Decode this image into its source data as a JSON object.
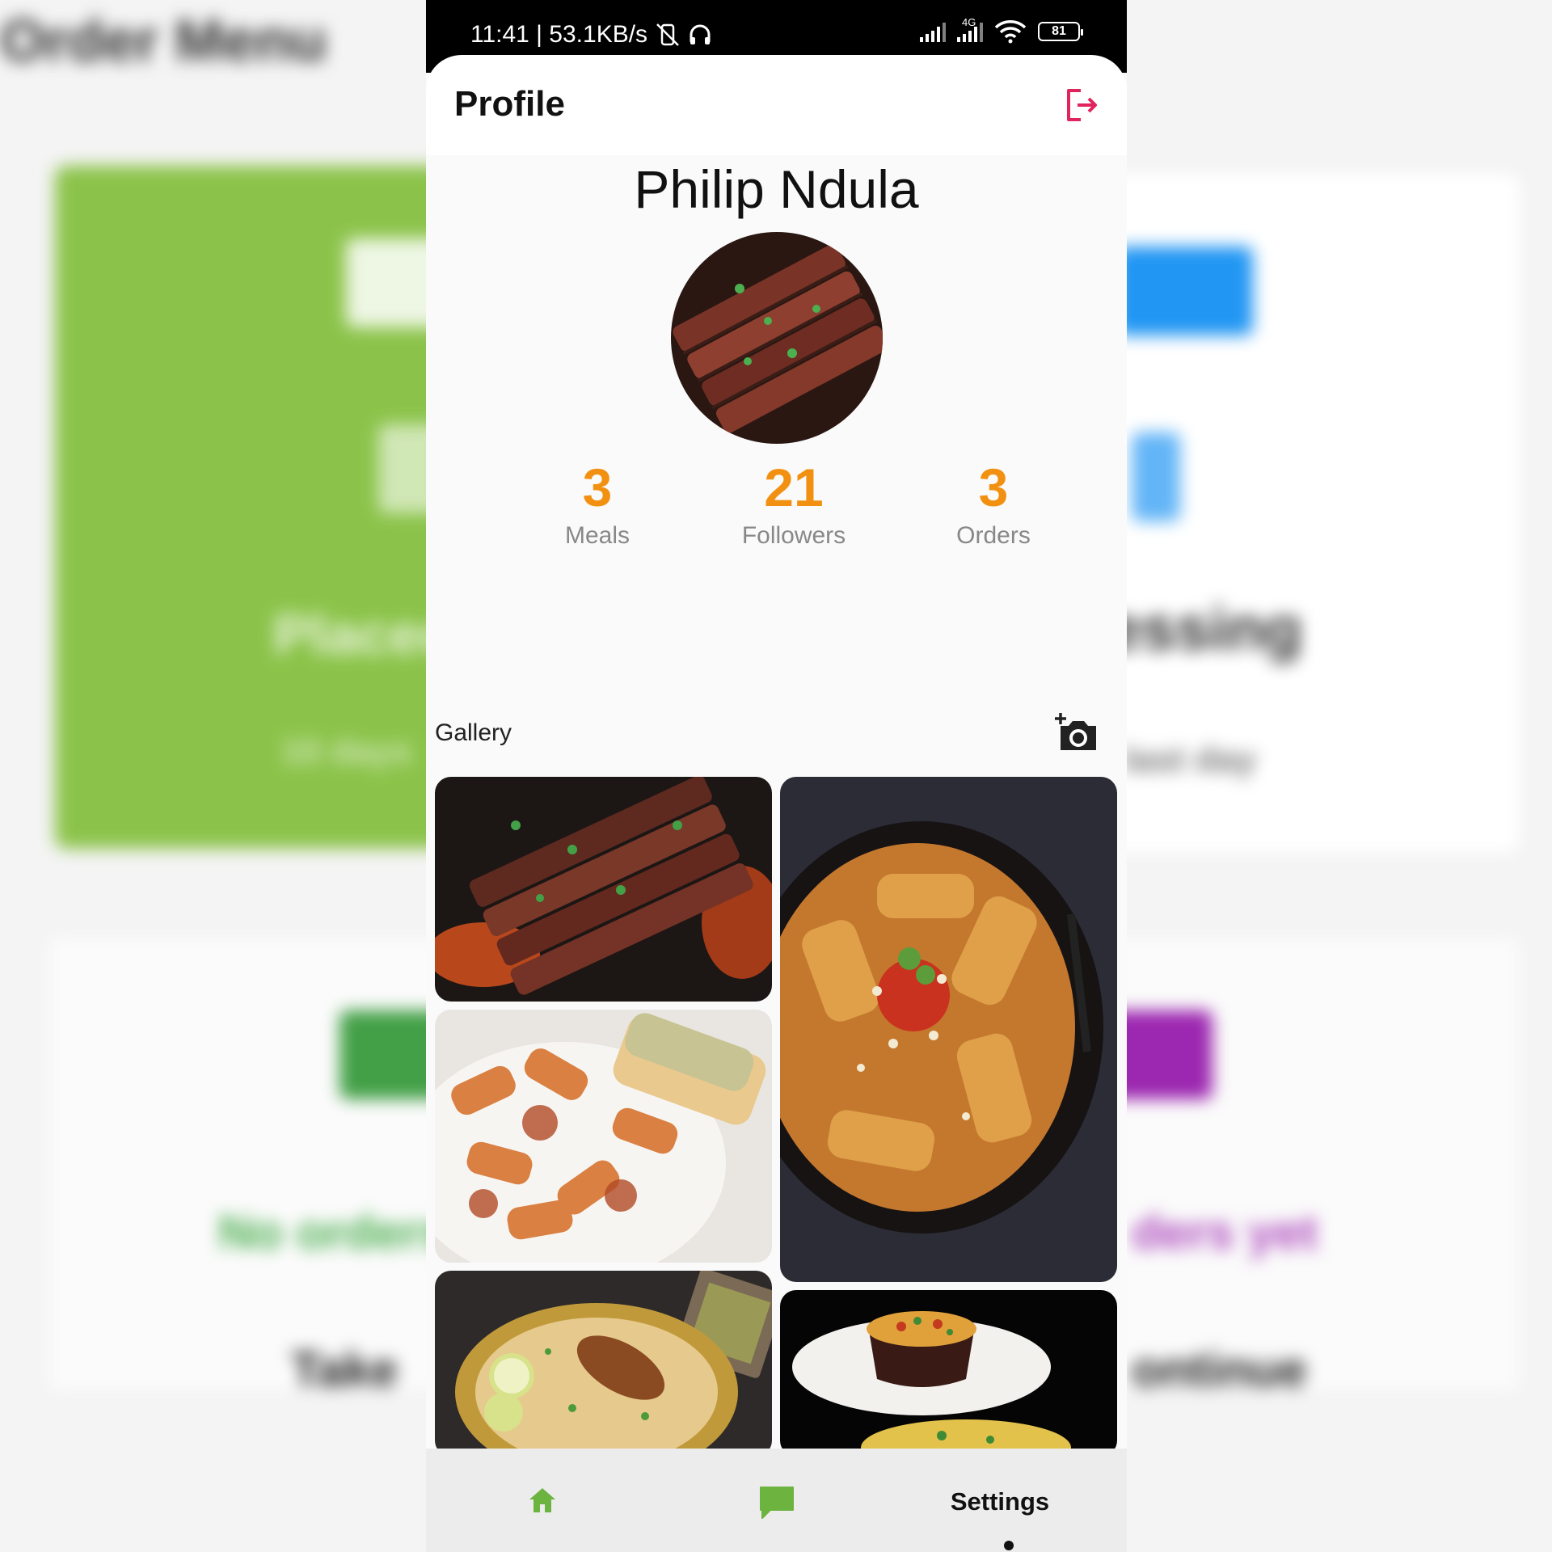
{
  "background_app": {
    "title": "Order Menu",
    "green_card_text": "Placed",
    "green_card_sub": "10 days",
    "white_card_text": "essing",
    "white_card_sub": "last day",
    "strip_left_text": "No orders",
    "strip_right_text": "ders yet",
    "strip_bottom_left": "Take",
    "strip_bottom_right": "ontinue"
  },
  "status_bar": {
    "time_speed": "11:41 | 53.1KB/s",
    "network": "4G",
    "battery": "81"
  },
  "app_bar": {
    "title": "Profile",
    "logout_icon": "logout-icon"
  },
  "profile": {
    "name": "Philip Ndula"
  },
  "stats": [
    {
      "value": "3",
      "label": "Meals"
    },
    {
      "value": "21",
      "label": "Followers"
    },
    {
      "value": "3",
      "label": "Orders"
    }
  ],
  "gallery": {
    "label": "Gallery",
    "add_icon": "add-photo-icon",
    "images": [
      "sliced-steak",
      "rigatoni-bowl",
      "baked-pasta-garlic-bread",
      "chicken-biryani",
      "rice-plate-dark"
    ]
  },
  "bottom_nav": {
    "home_icon": "home-icon",
    "chat_icon": "chat-icon",
    "settings_label": "Settings"
  },
  "colors": {
    "accent_orange": "#f29111",
    "logout_pink": "#e0245e",
    "nav_green": "#6cb33f",
    "bg_green": "#8bc34a"
  }
}
